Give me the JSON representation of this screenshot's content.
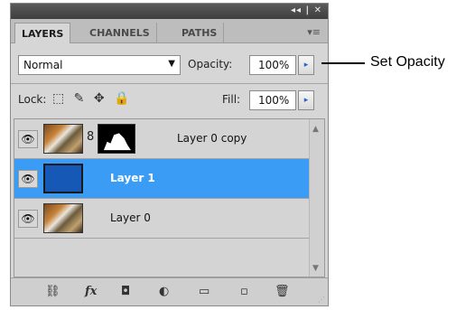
{
  "panel": {
    "collapse_glyph": "◂◂ | ✕",
    "tabs": [
      {
        "label": "LAYERS",
        "active": true
      },
      {
        "label": "CHANNELS",
        "active": false
      },
      {
        "label": "PATHS",
        "active": false
      }
    ],
    "menu_icon": "▾≡"
  },
  "blend": {
    "mode": "Normal",
    "caret": "▼"
  },
  "opacity": {
    "label": "Opacity:",
    "value": "100%",
    "arrow": "▸"
  },
  "lock": {
    "label": "Lock:",
    "icons": [
      "lock-transparent-icon",
      "lock-image-icon",
      "lock-position-icon",
      "lock-all-icon"
    ],
    "glyphs": "⬚ ✎ ✥ 🔒"
  },
  "fill": {
    "label": "Fill:",
    "value": "100%",
    "arrow": "▸"
  },
  "layers": [
    {
      "name": "Layer 0 copy",
      "visible": true,
      "selected": false,
      "has_mask": true
    },
    {
      "name": "Layer 1",
      "visible": true,
      "selected": true,
      "has_mask": false
    },
    {
      "name": "Layer 0",
      "visible": true,
      "selected": false,
      "has_mask": false
    }
  ],
  "footer_icons": [
    "link-layers-icon",
    "fx-icon",
    "add-mask-icon",
    "adjustment-layer-icon",
    "new-group-icon",
    "new-layer-icon",
    "trash-icon"
  ],
  "footer_glyphs": {
    "link": "⛓",
    "fx": "fx",
    "mask": "◘",
    "adjust": "◐",
    "group": "▭",
    "new": "▫",
    "trash": "🗑"
  },
  "eye_glyph": "👁",
  "chain_glyph": "8",
  "callout": {
    "text": "Set Opacity"
  },
  "colors": {
    "selected_row": "#3b9cf5",
    "layer1_fill": "#1558b5",
    "panel_bg": "#d6d6d6"
  }
}
